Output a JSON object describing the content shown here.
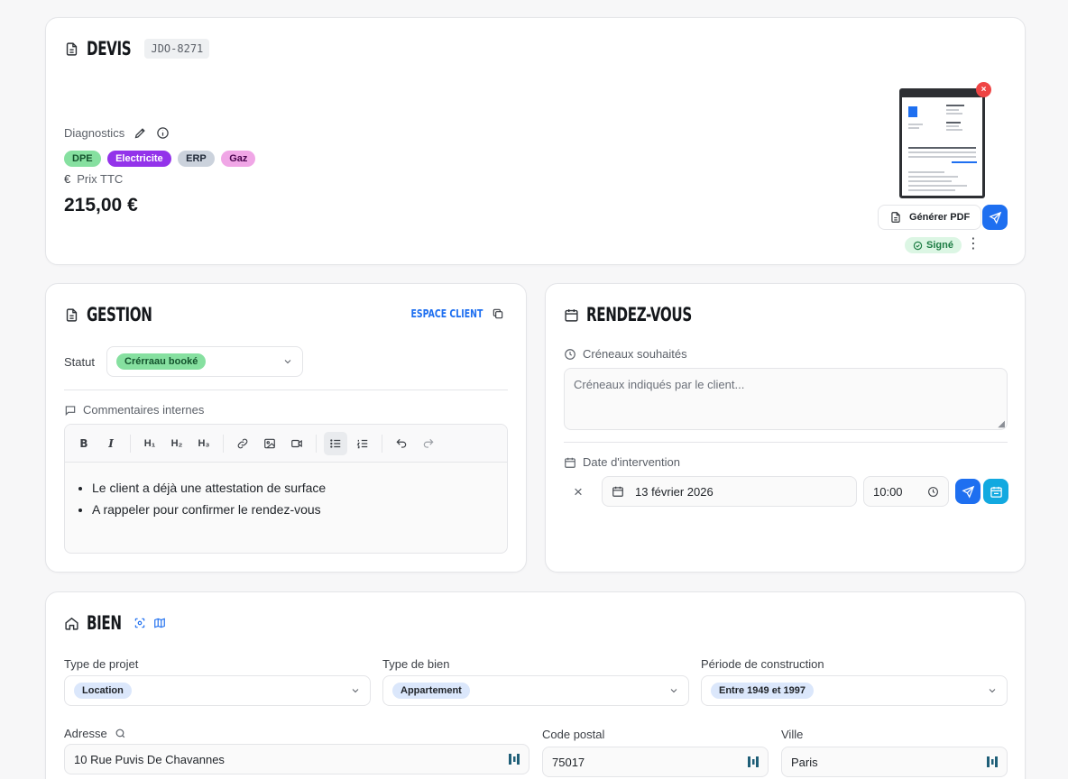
{
  "devis": {
    "title": "DEVIS",
    "ref": "JDO-8271",
    "diagnostics_label": "Diagnostics",
    "tags": [
      {
        "label": "DPE",
        "bg": "#86e0a0",
        "fg": "#14532d"
      },
      {
        "label": "Electricite",
        "bg": "#9333ea",
        "fg": "#ffffff"
      },
      {
        "label": "ERP",
        "bg": "#cbd2dc",
        "fg": "#1f2937"
      },
      {
        "label": "Gaz",
        "bg": "#f0a6e6",
        "fg": "#4a044e"
      }
    ],
    "price_label": "Prix TTC",
    "price_value": "215,00 €",
    "generate_pdf_label": "Générer PDF",
    "status_badge": "Signé"
  },
  "gestion": {
    "title": "GESTION",
    "espace_client_label": "ESPACE CLIENT",
    "statut_label": "Statut",
    "statut_value": "Crérraau booké",
    "comments_label": "Commentaires internes",
    "toolbar": {
      "h1": "H₁",
      "h2": "H₂",
      "h3": "H₃"
    },
    "comments": [
      "Le client a déjà une attestation de surface",
      "A rappeler pour confirmer le rendez-vous"
    ]
  },
  "rdv": {
    "title": "RENDEZ-VOUS",
    "creneaux_label": "Créneaux souhaités",
    "creneaux_placeholder": "Créneaux indiqués par le client...",
    "date_label": "Date d'intervention",
    "date_value": "13 février 2026",
    "time_value": "10:00"
  },
  "bien": {
    "title": "BIEN",
    "type_projet_label": "Type de projet",
    "type_projet_value": "Location",
    "type_bien_label": "Type de bien",
    "type_bien_value": "Appartement",
    "periode_label": "Période de construction",
    "periode_value": "Entre 1949 et 1997",
    "adresse_label": "Adresse",
    "adresse_value": "10 Rue Puvis De Chavannes",
    "cp_label": "Code postal",
    "cp_value": "75017",
    "ville_label": "Ville",
    "ville_value": "Paris"
  },
  "colors": {
    "accent": "#1e6ff0",
    "accent_cyan": "#12a9e0",
    "success": "#1c7c43",
    "danger": "#ef4444"
  },
  "icons": [
    "document-icon",
    "pencil-icon",
    "info-icon",
    "euro-icon",
    "send-icon",
    "check-circle-icon",
    "more-vertical-icon",
    "copy-icon",
    "chevron-down-icon",
    "message-icon",
    "bold-icon",
    "italic-icon",
    "link-icon",
    "image-icon",
    "video-icon",
    "bullet-list-icon",
    "ordered-list-icon",
    "undo-icon",
    "redo-icon",
    "calendar-icon",
    "clock-icon",
    "close-icon",
    "calendar-sync-icon",
    "home-icon",
    "scan-icon",
    "map-icon",
    "search-icon",
    "password-manager-icon"
  ]
}
